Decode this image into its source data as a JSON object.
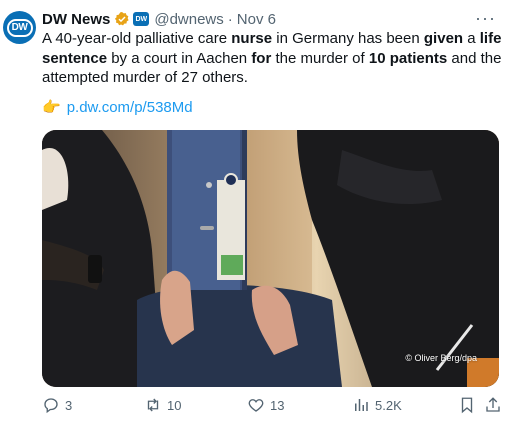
{
  "author": {
    "name": "DW News",
    "handle": "@dwnews",
    "separator": "·",
    "date": "Nov 6",
    "avatar_text": "DW",
    "affiliate_badge_text": "DW"
  },
  "tweet": {
    "t1": "A 40-year-old palliative care ",
    "b1": "nurse",
    "t2": " in Germany has been ",
    "b2": "given",
    "t3": " a ",
    "b3": "life sentence",
    "t4": " by a court in Aachen ",
    "b4": "for",
    "t5": " the murder of ",
    "b5": "10 patients",
    "t6": " and the attempted murder of 27 others."
  },
  "link": {
    "emoji": "👉",
    "text": "p.dw.com/p/538Md"
  },
  "media": {
    "credit": "© Oliver Berg/dpa"
  },
  "actions": {
    "replies": "3",
    "reposts": "10",
    "likes": "13",
    "views": "5.2K"
  },
  "icons": [
    "more-icon",
    "verified-badge-icon",
    "reply-icon",
    "repost-icon",
    "like-icon",
    "views-icon",
    "bookmark-icon",
    "share-icon"
  ],
  "colors": {
    "accent": "#1d9bf0",
    "brand": "#0a6fb5",
    "verified": "#e8a317",
    "muted": "#536471"
  }
}
